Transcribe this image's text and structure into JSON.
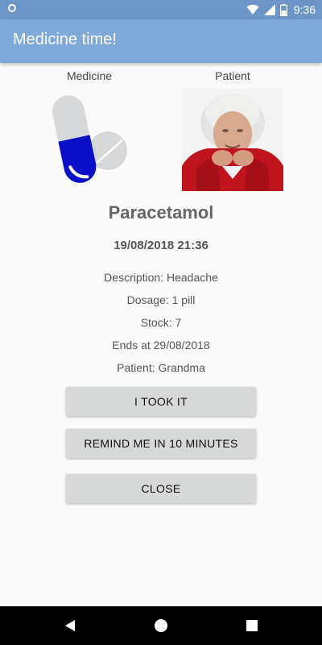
{
  "status_bar": {
    "time": "9:36",
    "icons": [
      "notification-icon",
      "wifi-icon",
      "signal-icon",
      "battery-icon"
    ]
  },
  "app_bar": {
    "title": "Medicine time!",
    "color": "#7fa9d8"
  },
  "labels": {
    "medicine": "Medicine",
    "patient": "Patient"
  },
  "medicine": {
    "name": "Paracetamol",
    "datetime": "19/08/2018 21:36",
    "description": "Description: Headache",
    "dosage": "Dosage: 1 pill",
    "stock": "Stock: 7",
    "ends": "Ends at 29/08/2018",
    "patient": "Patient: Grandma",
    "pill_color": "#0a10c8"
  },
  "buttons": {
    "took_it": "I TOOK IT",
    "remind": "REMIND ME IN 10 MINUTES",
    "close": "CLOSE"
  },
  "nav_bar": {
    "icons": [
      "back-icon",
      "home-icon",
      "recents-icon"
    ]
  }
}
